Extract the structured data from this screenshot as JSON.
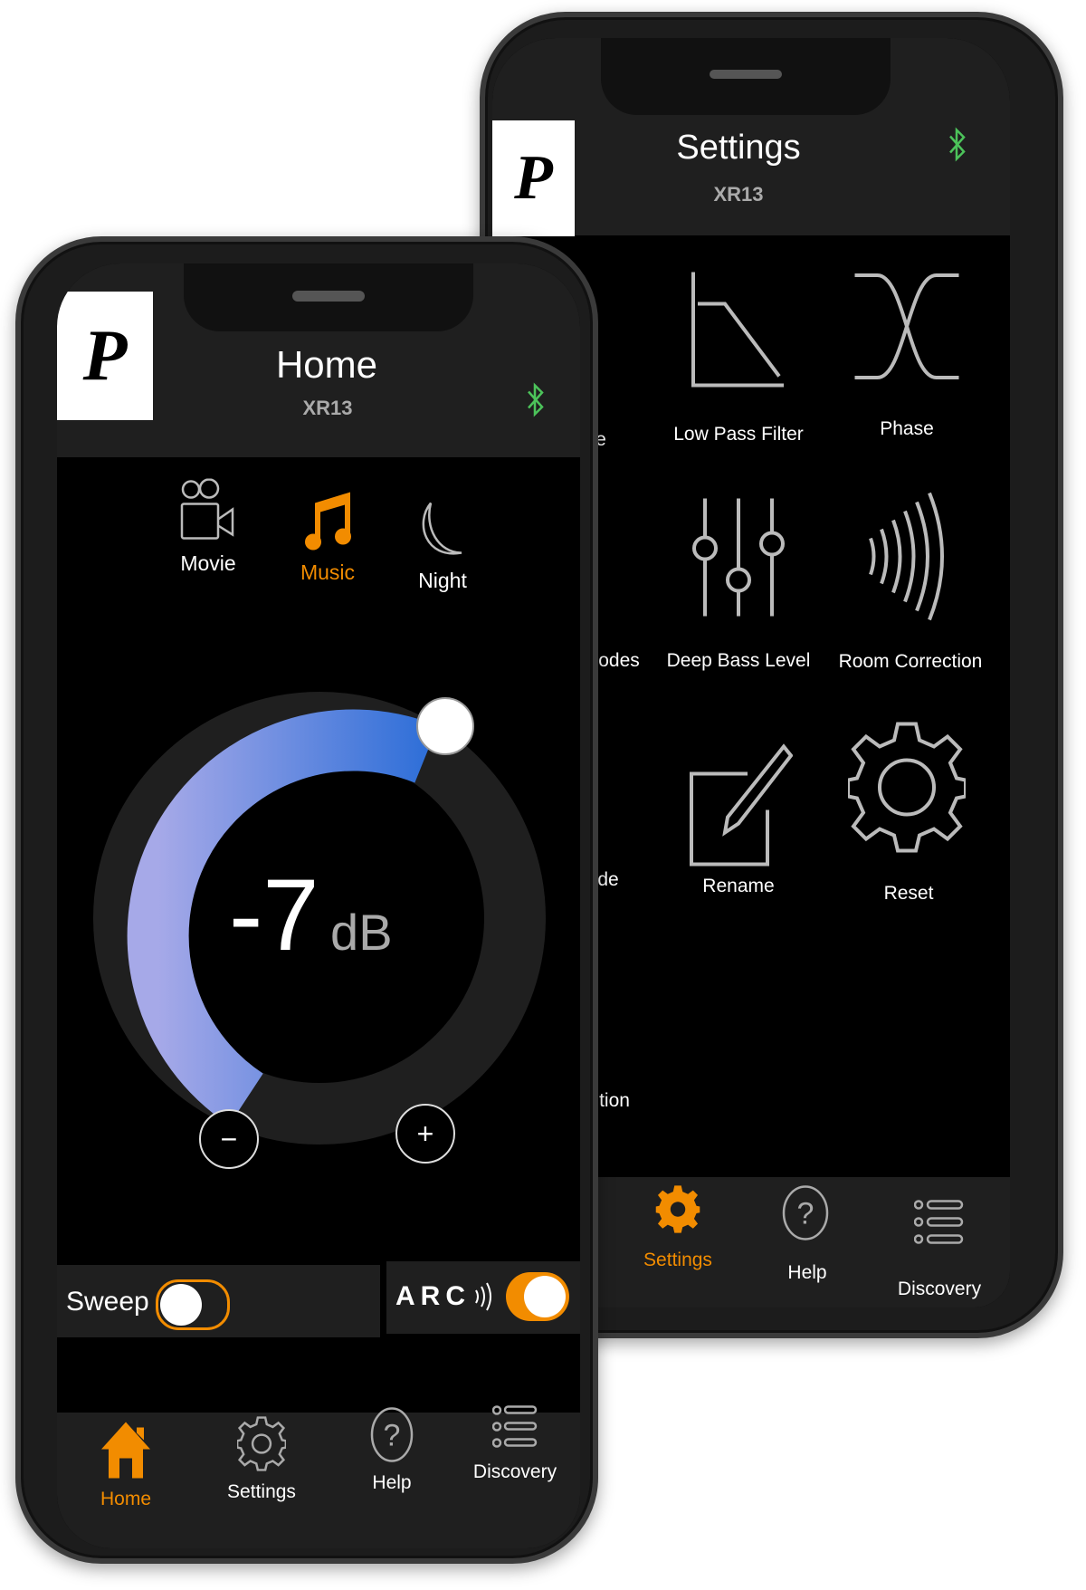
{
  "colors": {
    "accent": "#f28c00",
    "bluetooth": "#4cc35a",
    "dial_start": "#a6a9e8",
    "dial_end": "#2f6fd8",
    "panel": "#1f1f1f"
  },
  "back_phone": {
    "header": {
      "title": "Settings",
      "subtitle": "XR13",
      "logo": "P",
      "bluetooth_icon": "bluetooth-icon"
    },
    "grid": [
      {
        "label": "e",
        "icon": "partial-icon"
      },
      {
        "label": "Low Pass Filter",
        "icon": "low-pass-filter-icon"
      },
      {
        "label": "Phase",
        "icon": "phase-icon"
      },
      {
        "label": "odes",
        "icon": "partial-icon"
      },
      {
        "label": "Deep Bass Level",
        "icon": "sliders-icon"
      },
      {
        "label": "Room Correction",
        "icon": "room-correction-icon"
      },
      {
        "label": "de",
        "icon": "partial-icon"
      },
      {
        "label": "Rename",
        "icon": "edit-icon"
      },
      {
        "label": "Reset",
        "icon": "gear-icon"
      },
      {
        "label": "tion",
        "icon": "partial-icon"
      }
    ],
    "tabs": [
      {
        "label": "Settings",
        "icon": "gear-icon",
        "active": true
      },
      {
        "label": "Help",
        "icon": "help-icon",
        "active": false
      },
      {
        "label": "Discovery",
        "icon": "list-icon",
        "active": false
      }
    ]
  },
  "front_phone": {
    "header": {
      "title": "Home",
      "subtitle": "XR13",
      "logo": "P",
      "bluetooth_icon": "bluetooth-icon"
    },
    "modes": [
      {
        "label": "Movie",
        "icon": "movie-camera-icon",
        "active": false
      },
      {
        "label": "Music",
        "icon": "music-note-icon",
        "active": true
      },
      {
        "label": "Night",
        "icon": "moon-icon",
        "active": false
      }
    ],
    "volume": {
      "value": "-7",
      "unit": "dB",
      "minus": "−",
      "plus": "+"
    },
    "sweep": {
      "label": "Sweep",
      "on": false
    },
    "arc": {
      "label": "ARC",
      "on": true
    },
    "tabs": [
      {
        "label": "Home",
        "icon": "home-icon",
        "active": true
      },
      {
        "label": "Settings",
        "icon": "gear-icon",
        "active": false
      },
      {
        "label": "Help",
        "icon": "help-icon",
        "active": false
      },
      {
        "label": "Discovery",
        "icon": "list-icon",
        "active": false
      }
    ]
  }
}
